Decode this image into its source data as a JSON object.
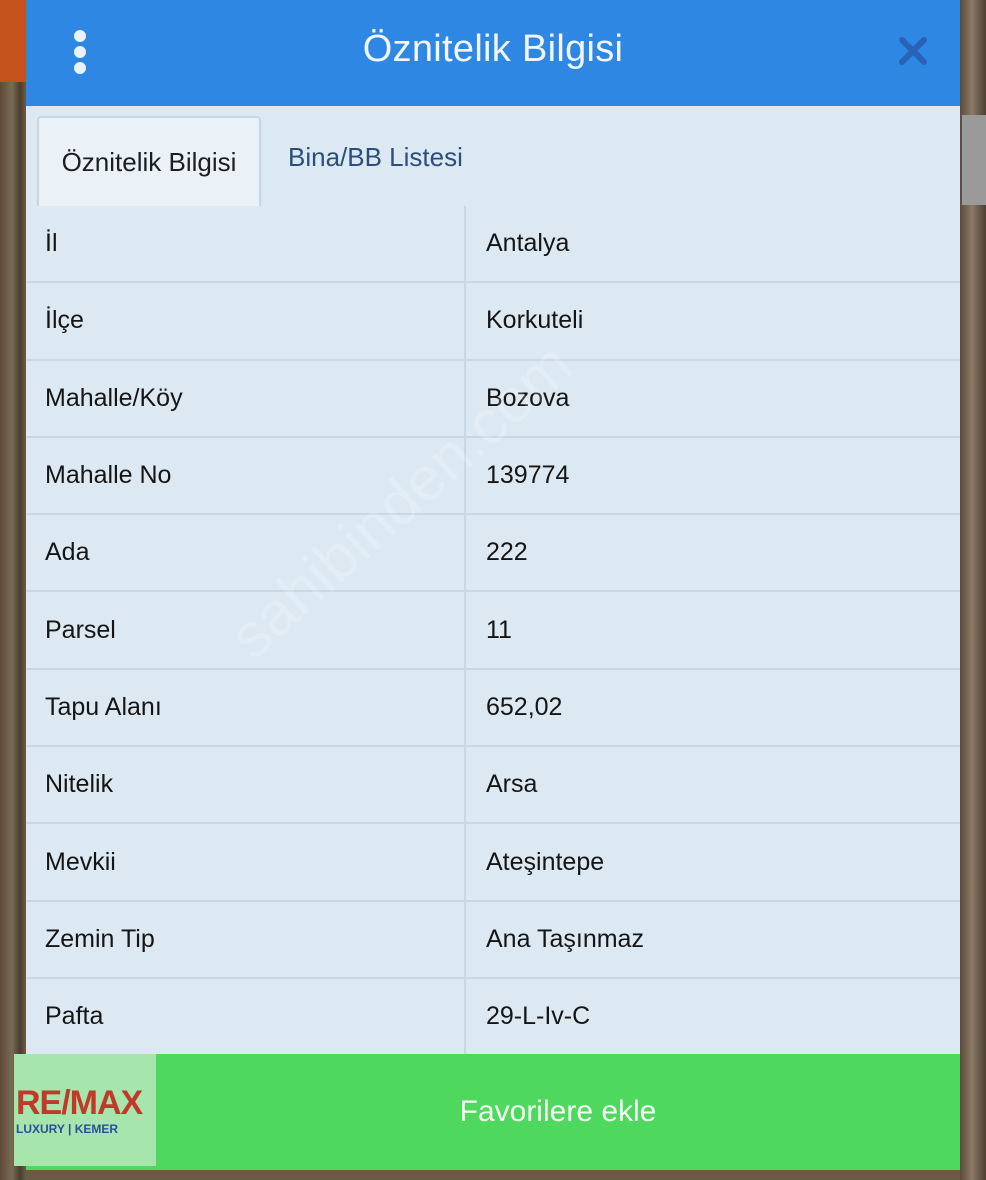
{
  "header": {
    "title": "Öznitelik Bilgisi",
    "menu_icon": "vertical-dots-icon",
    "close_icon": "close-icon",
    "color": "#2e87e3"
  },
  "tabs": [
    {
      "label": "Öznitelik Bilgisi",
      "active": true
    },
    {
      "label": "Bina/BB Listesi",
      "active": false
    }
  ],
  "attributes": [
    {
      "key": "İl",
      "value": "Antalya"
    },
    {
      "key": "İlçe",
      "value": "Korkuteli"
    },
    {
      "key": "Mahalle/Köy",
      "value": "Bozova"
    },
    {
      "key": "Mahalle No",
      "value": "139774"
    },
    {
      "key": "Ada",
      "value": "222"
    },
    {
      "key": "Parsel",
      "value": "11"
    },
    {
      "key": "Tapu Alanı",
      "value": "652,02"
    },
    {
      "key": "Nitelik",
      "value": "Arsa"
    },
    {
      "key": "Mevkii",
      "value": "Ateşintepe"
    },
    {
      "key": "Zemin Tip",
      "value": "Ana Taşınmaz"
    },
    {
      "key": "Pafta",
      "value": "29-L-Iv-C"
    }
  ],
  "footer": {
    "button_label": "Favorilere ekle",
    "color": "#4fd85e"
  },
  "logo": {
    "brand": "RE/MAX",
    "sub": "LUXURY | KEMER"
  },
  "watermark": "sahibinden.com"
}
